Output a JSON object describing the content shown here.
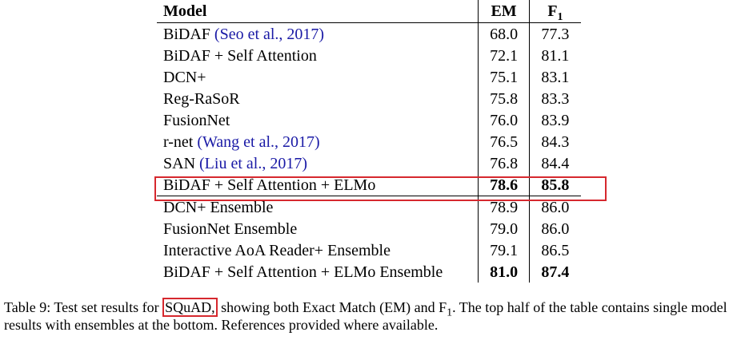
{
  "table": {
    "headers": {
      "model": "Model",
      "em": "EM",
      "f1_main": "F",
      "f1_sub": "1"
    },
    "rows": [
      {
        "model": "BiDAF",
        "cite": "(Seo et al., 2017)",
        "em": "68.0",
        "f1": "77.3"
      },
      {
        "model": "BiDAF + Self Attention",
        "cite": "",
        "em": "72.1",
        "f1": "81.1"
      },
      {
        "model": "DCN+",
        "cite": "",
        "em": "75.1",
        "f1": "83.1"
      },
      {
        "model": "Reg-RaSoR",
        "cite": "",
        "em": "75.8",
        "f1": "83.3"
      },
      {
        "model": "FusionNet",
        "cite": "",
        "em": "76.0",
        "f1": "83.9"
      },
      {
        "model": "r-net",
        "cite": "(Wang et al., 2017)",
        "em": "76.5",
        "f1": "84.3"
      },
      {
        "model": "SAN",
        "cite": "(Liu et al., 2017)",
        "em": "76.8",
        "f1": "84.4"
      },
      {
        "model": "BiDAF + Self Attention + ELMo",
        "cite": "",
        "em": "78.6",
        "f1": "85.8"
      },
      {
        "model": "DCN+ Ensemble",
        "cite": "",
        "em": "78.9",
        "f1": "86.0"
      },
      {
        "model": "FusionNet Ensemble",
        "cite": "",
        "em": "79.0",
        "f1": "86.0"
      },
      {
        "model": "Interactive AoA Reader+ Ensemble",
        "cite": "",
        "em": "79.1",
        "f1": "86.5"
      },
      {
        "model": "BiDAF + Self Attention + ELMo Ensemble",
        "cite": "",
        "em": "81.0",
        "f1": "87.4"
      }
    ]
  },
  "caption": {
    "before": "Table 9: Test set results for ",
    "highlight": "SQuAD,",
    "middle": " showing both Exact Match (EM) and F",
    "sub": "1",
    "after": ". The top half of the table contains single model results with ensembles at the bottom. References provided where available."
  },
  "colors": {
    "highlight": "#d6282e",
    "citation": "#1a1aa6"
  }
}
